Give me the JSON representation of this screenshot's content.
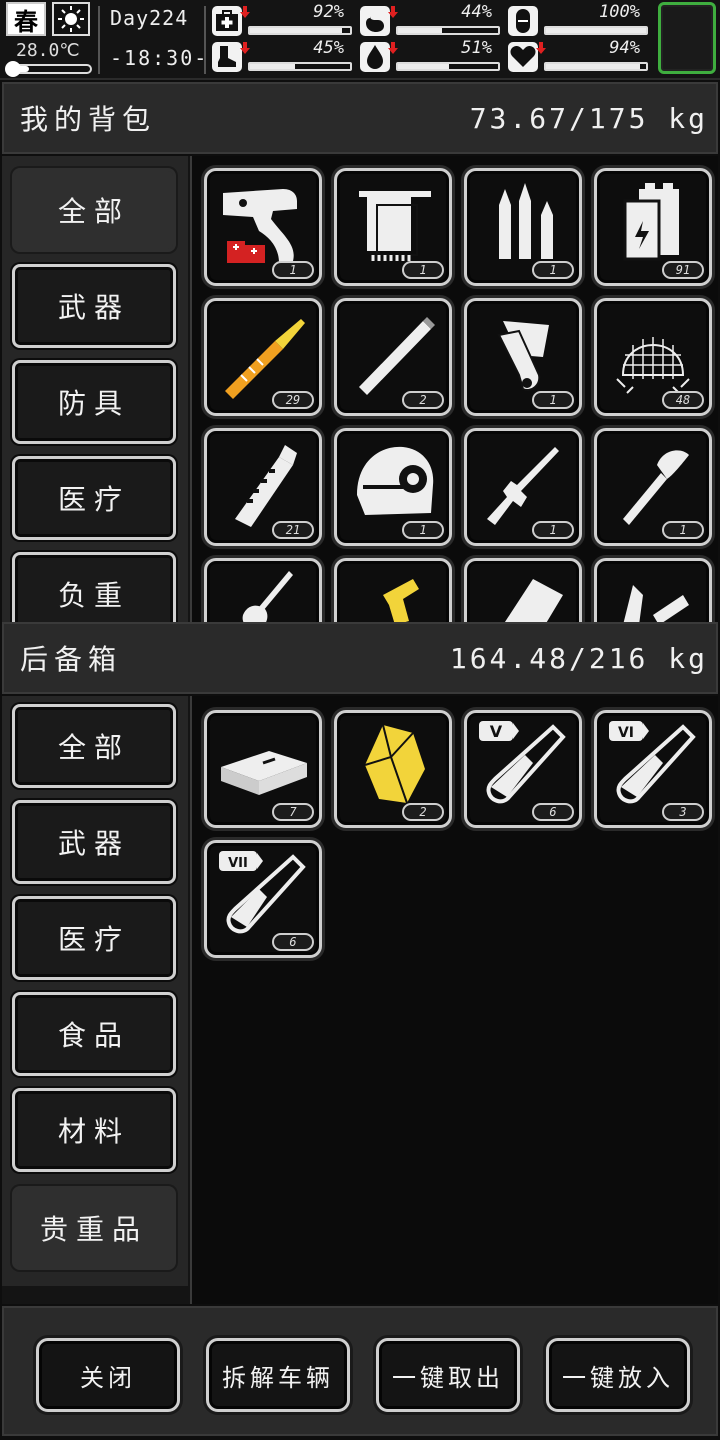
{
  "status": {
    "season": "春",
    "temperature": "28.0℃",
    "temperature_level": 0.25,
    "day": "Day224",
    "time": "-18:30-",
    "stats": [
      {
        "name": "health",
        "icon": "medkit-icon",
        "value": "92%",
        "level": 0.92,
        "trend": "down"
      },
      {
        "name": "hunger",
        "icon": "stomach-icon",
        "value": "44%",
        "level": 0.44,
        "trend": "down"
      },
      {
        "name": "pills",
        "icon": "pill-icon",
        "value": "100%",
        "level": 1.0,
        "trend": "none"
      },
      {
        "name": "stamina",
        "icon": "boot-icon",
        "value": "45%",
        "level": 0.45,
        "trend": "down"
      },
      {
        "name": "thirst",
        "icon": "water-drop-icon",
        "value": "51%",
        "level": 0.51,
        "trend": "down"
      },
      {
        "name": "mood",
        "icon": "heart-icon",
        "value": "94%",
        "level": 0.94,
        "trend": "down"
      }
    ]
  },
  "backpack": {
    "title": "我的背包",
    "weight": "73.67/175 kg",
    "categories": [
      "全部",
      "武器",
      "防具",
      "医疗",
      "负重"
    ],
    "active_category": "全部",
    "items": [
      {
        "icon": "flare-gun-icon",
        "count": "1"
      },
      {
        "icon": "towel-icon",
        "count": "1"
      },
      {
        "icon": "bullets-icon",
        "count": "1"
      },
      {
        "icon": "battery-icon",
        "count": "91"
      },
      {
        "icon": "rocket-ammo-icon",
        "count": "29"
      },
      {
        "icon": "cigarette-icon",
        "count": "2"
      },
      {
        "icon": "scroll-icon",
        "count": "1"
      },
      {
        "icon": "net-icon",
        "count": "48"
      },
      {
        "icon": "grenade-icon",
        "count": "21"
      },
      {
        "icon": "helmet-icon",
        "count": "1"
      },
      {
        "icon": "rifle-icon",
        "count": "1"
      },
      {
        "icon": "axe-icon",
        "count": "1"
      },
      {
        "icon": "shovel-icon",
        "count": ""
      },
      {
        "icon": "drill-icon",
        "count": ""
      },
      {
        "icon": "case-icon",
        "count": ""
      },
      {
        "icon": "scrap-icon",
        "count": ""
      }
    ]
  },
  "storage": {
    "title": "后备箱",
    "weight": "164.48/216 kg",
    "categories": [
      "全部",
      "武器",
      "医疗",
      "食品",
      "材料",
      "贵重品"
    ],
    "active_category": "贵重品",
    "items": [
      {
        "icon": "money-stack-icon",
        "count": "7"
      },
      {
        "icon": "gold-nugget-icon",
        "count": "2"
      },
      {
        "icon": "test-tube-v-icon",
        "count": "6",
        "tier": "V"
      },
      {
        "icon": "test-tube-vi-icon",
        "count": "3",
        "tier": "VI"
      },
      {
        "icon": "test-tube-vii-icon",
        "count": "6",
        "tier": "VII"
      }
    ]
  },
  "actions": {
    "close": "关闭",
    "dismantle": "拆解车辆",
    "take_all": "一键取出",
    "put_all": "一键放入"
  },
  "colors": {
    "quick_slot_border": "#3fae3f",
    "warning_arrow": "#e02020",
    "gold": "#f2d43a",
    "orange": "#f0a020"
  }
}
